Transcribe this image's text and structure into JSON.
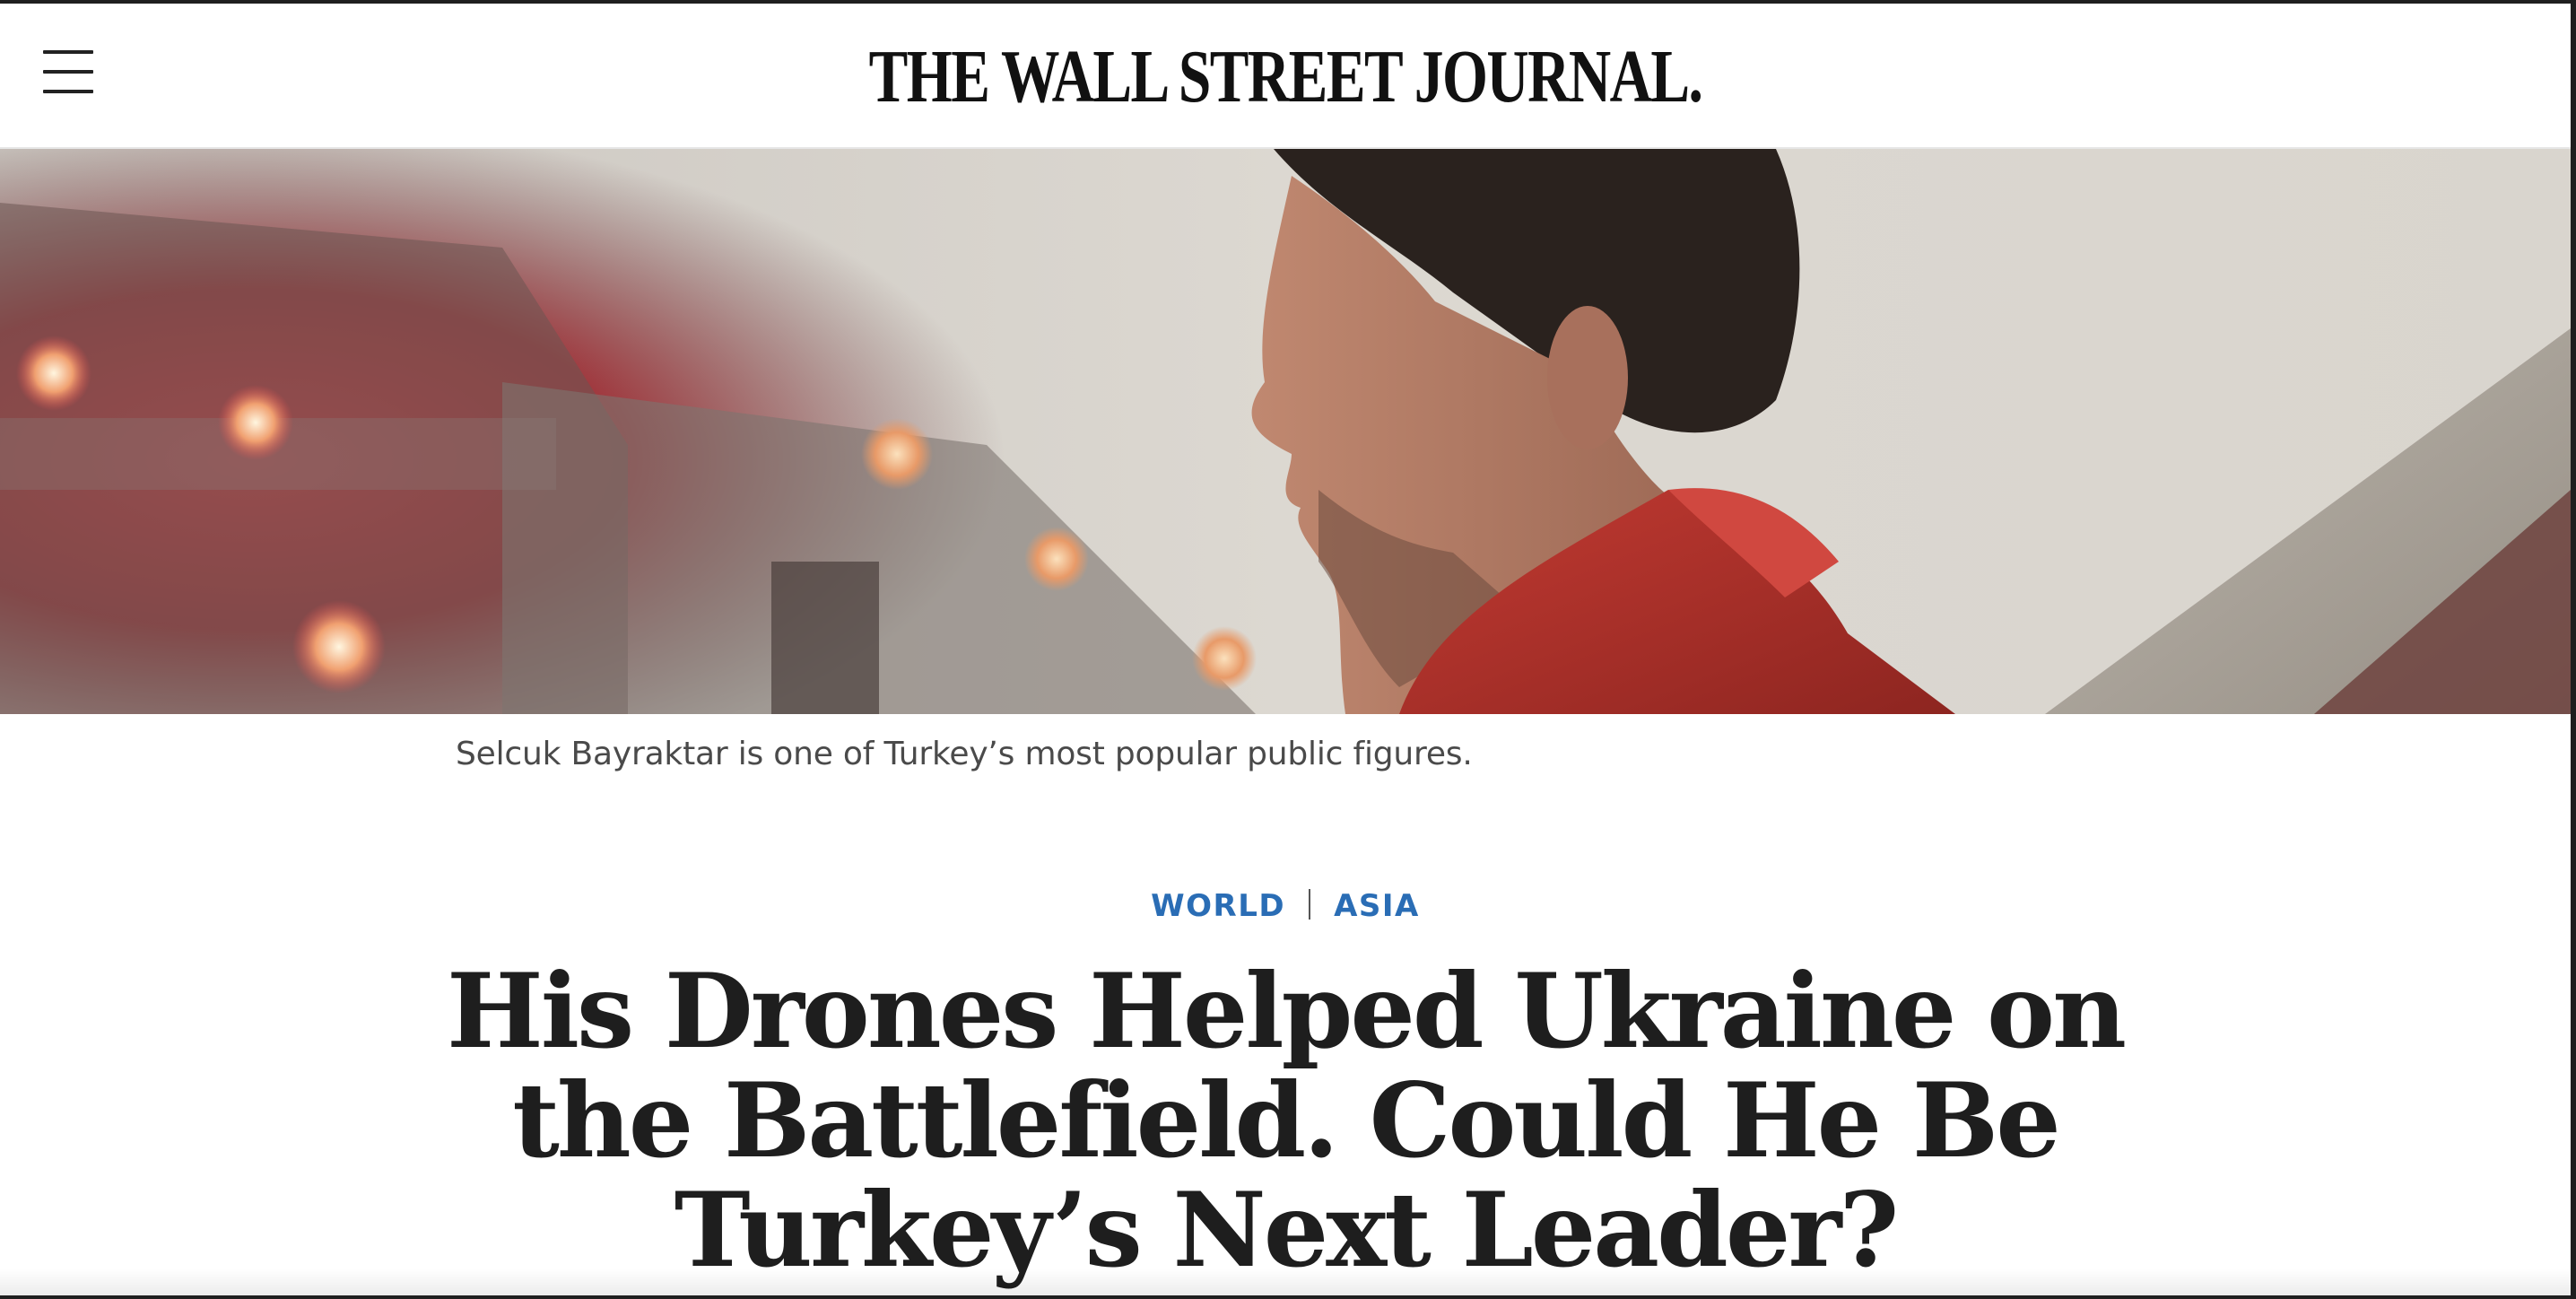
{
  "masthead": {
    "logo_text": "THE WALL STREET JOURNAL.",
    "menu_icon": "hamburger-menu-icon"
  },
  "hero": {
    "caption": "Selcuk Bayraktar is one of Turkey’s most popular public figures."
  },
  "article": {
    "sections": [
      {
        "label": "WORLD"
      },
      {
        "label": "ASIA"
      }
    ],
    "headline": "His Drones Helped Ukraine on the Battlefield. Could He Be Turkey’s Next Leader?"
  },
  "colors": {
    "section_link": "#2a6db5",
    "headline": "#1e1e1e",
    "caption": "#4a4a4a"
  }
}
